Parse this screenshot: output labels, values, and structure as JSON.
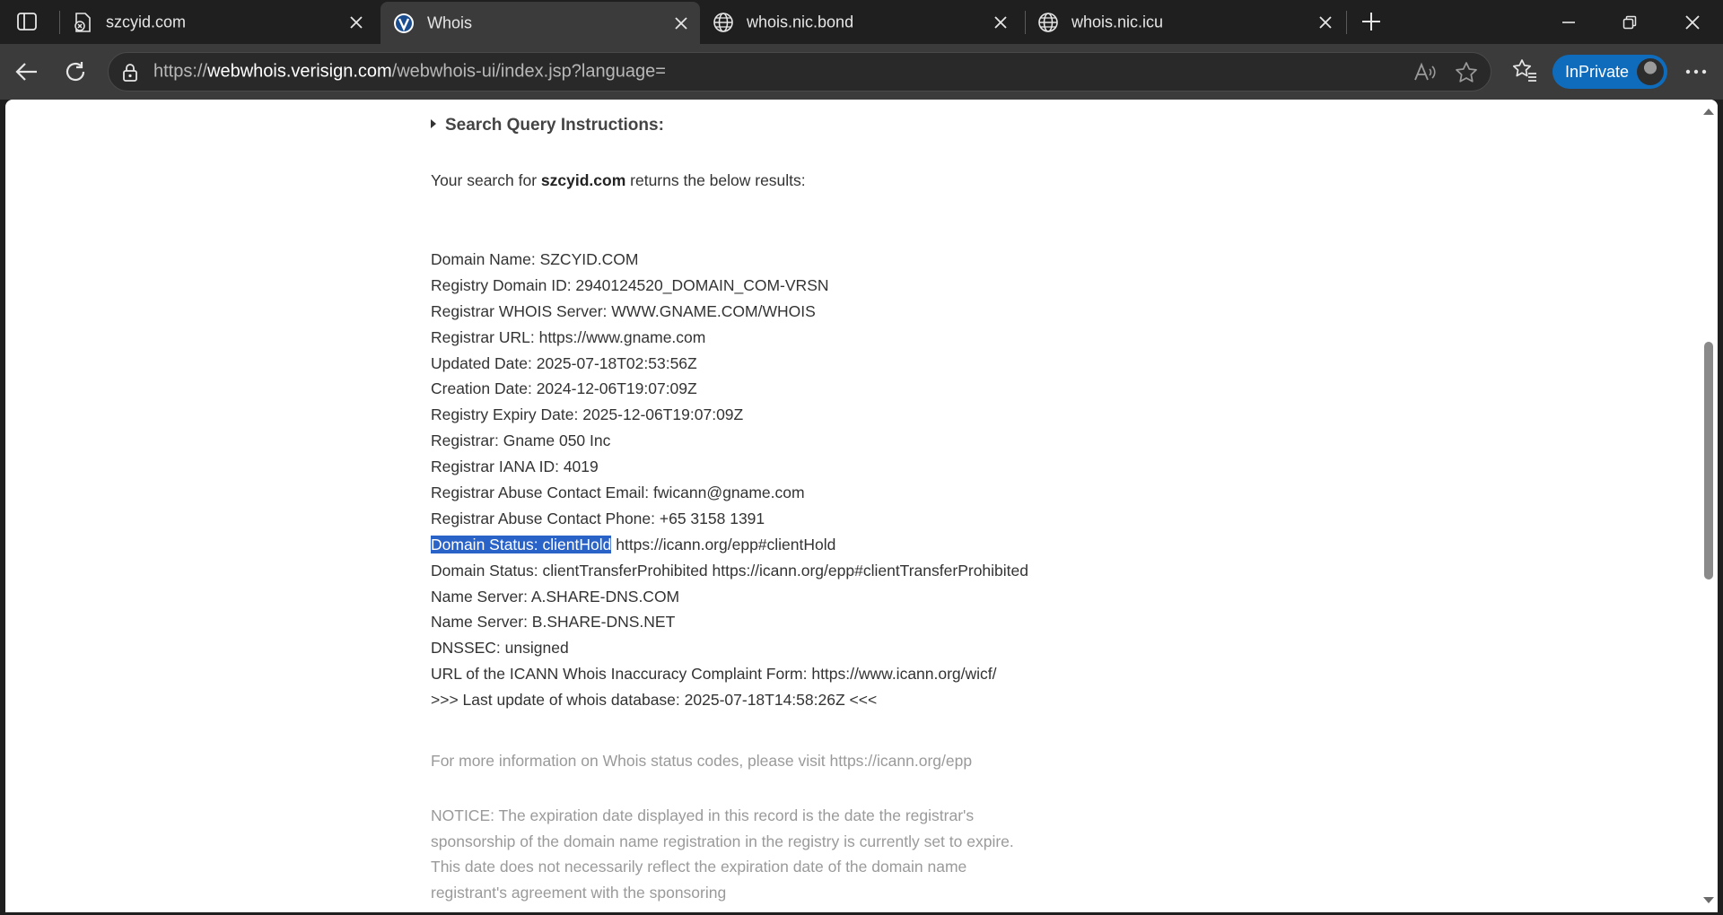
{
  "browser": {
    "tabs": [
      {
        "title": "szcyid.com",
        "favicon": "error-page-icon",
        "active": false
      },
      {
        "title": "Whois",
        "favicon": "verisign-icon",
        "active": true
      },
      {
        "title": "whois.nic.bond",
        "favicon": "globe-icon",
        "active": false
      },
      {
        "title": "whois.nic.icu",
        "favicon": "globe-icon",
        "active": false
      }
    ],
    "address": {
      "scheme": "https://",
      "host": "webwhois.verisign.com",
      "path": "/webwhois-ui/index.jsp?language="
    },
    "inprivate_label": "InPrivate",
    "accent_color": "#0f6cbd"
  },
  "page": {
    "instructions_label": "Search Query Instructions:",
    "search": {
      "prefix": "Your search for",
      "domain": "szcyid.com",
      "suffix": "returns the below results:"
    },
    "record": [
      "Domain Name: SZCYID.COM",
      "Registry Domain ID: 2940124520_DOMAIN_COM-VRSN",
      "Registrar WHOIS Server: WWW.GNAME.COM/WHOIS",
      "Registrar URL: https://www.gname.com",
      "Updated Date: 2025-07-18T02:53:56Z",
      "Creation Date: 2024-12-06T19:07:09Z",
      "Registry Expiry Date: 2025-12-06T19:07:09Z",
      "Registrar: Gname 050 Inc",
      "Registrar IANA ID: 4019",
      "Registrar Abuse Contact Email: fwicann@gname.com",
      "Registrar Abuse Contact Phone: +65 3158 1391"
    ],
    "status_highlight": {
      "selected": "Domain Status: clientHold",
      "rest": " https://icann.org/epp#clientHold"
    },
    "record_tail": [
      "Domain Status: clientTransferProhibited https://icann.org/epp#clientTransferProhibited",
      "Name Server: A.SHARE-DNS.COM",
      "Name Server: B.SHARE-DNS.NET",
      "DNSSEC: unsigned",
      "URL of the ICANN Whois Inaccuracy Complaint Form: https://www.icann.org/wicf/",
      ">>> Last update of whois database: 2025-07-18T14:58:26Z <<<"
    ],
    "status_info": "For more information on Whois status codes, please visit https://icann.org/epp",
    "notice": "NOTICE: The expiration date displayed in this record is the date the registrar's sponsorship of the domain name registration in the registry is currently set to expire. This date does not necessarily reflect the expiration date of the domain name registrant's agreement with the sponsoring",
    "selection_color": "#2a63c8"
  }
}
